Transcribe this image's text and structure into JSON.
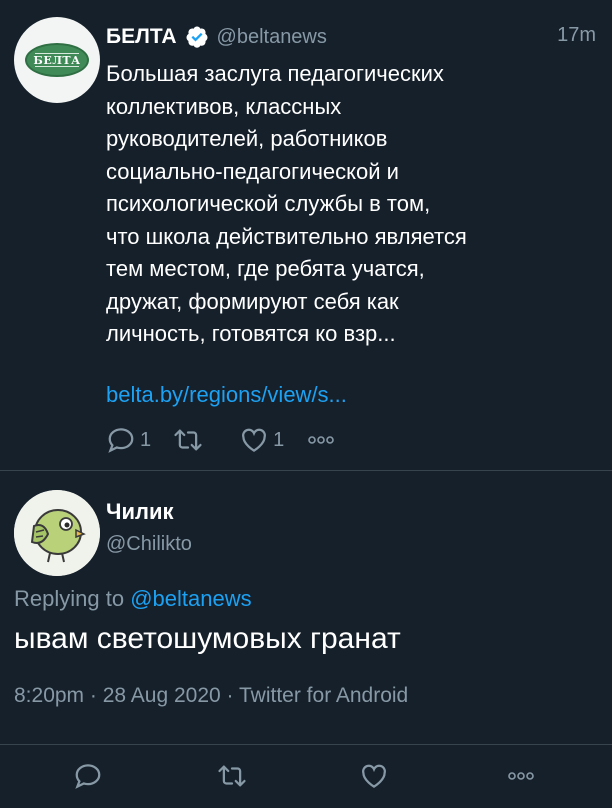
{
  "tweet": {
    "author_name": "БЕЛТА",
    "avatar_logo_text": "БЕЛТА",
    "handle": "@beltanews",
    "time_ago": "17m",
    "text": "Большая заслуга педагогических\nколлективов, классных\nруководителей, работников\nсоциально-педагогической и\nпсихологической службы в том,\nчто школа действительно является\nтем местом, где ребята учатся,\nдружат, формируют себя как\nличность, готовятся ко взр...",
    "link": "belta.by/regions/view/s...",
    "reply_count": "1",
    "like_count": "1",
    "icons": [
      "reply-icon",
      "retweet-icon",
      "like-icon",
      "more-icon",
      "verified-badge-icon"
    ]
  },
  "reply": {
    "author_name": "Чилик",
    "handle": "@Chilikto",
    "replying_prefix": "Replying to",
    "replying_to": "@beltanews",
    "text": "ывам светошумовых гранат",
    "time": "8:20pm",
    "date": "28 Aug 2020",
    "source": "Twitter for Android",
    "meta_separator": "·"
  },
  "bottom_bar": {
    "icons": [
      "reply-icon",
      "retweet-icon",
      "like-icon",
      "more-icon"
    ]
  },
  "colors": {
    "background": "#15202b",
    "text": "#ffffff",
    "secondary_text": "#8899a6",
    "accent": "#1da1f2",
    "divider": "#38444d"
  }
}
